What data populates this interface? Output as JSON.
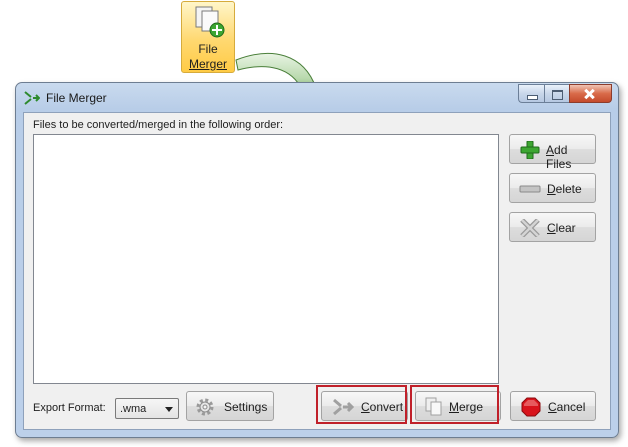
{
  "ribbon": {
    "label_line1": "File",
    "label_line2": "Merger",
    "icon": "document-add-icon"
  },
  "window": {
    "title": "File Merger",
    "icon": "merge-arrows-icon",
    "caption": [
      "minimize",
      "maximize",
      "close"
    ]
  },
  "main": {
    "files_label": "Files to be converted/merged in the following order:",
    "files": []
  },
  "side_buttons": {
    "add": {
      "label_u": "A",
      "label_rest": "dd Files",
      "icon": "plus-icon"
    },
    "delete": {
      "label_u": "D",
      "label_rest": "elete",
      "icon": "minus-icon"
    },
    "clear": {
      "label_u": "C",
      "label_rest": "lear",
      "icon": "x-icon"
    }
  },
  "bottom": {
    "export_label": "Export Format:",
    "export_value": ".wma",
    "settings_label": "Settings",
    "convert_label": "Convert",
    "convert_u": "C",
    "convert_rest": "onvert",
    "merge_u": "M",
    "merge_rest": "erge",
    "cancel_u": "C",
    "cancel_rest": "ancel"
  },
  "colors": {
    "highlight": "#c0202a",
    "accent_green": "#3da632",
    "stop_red": "#d8141c"
  }
}
